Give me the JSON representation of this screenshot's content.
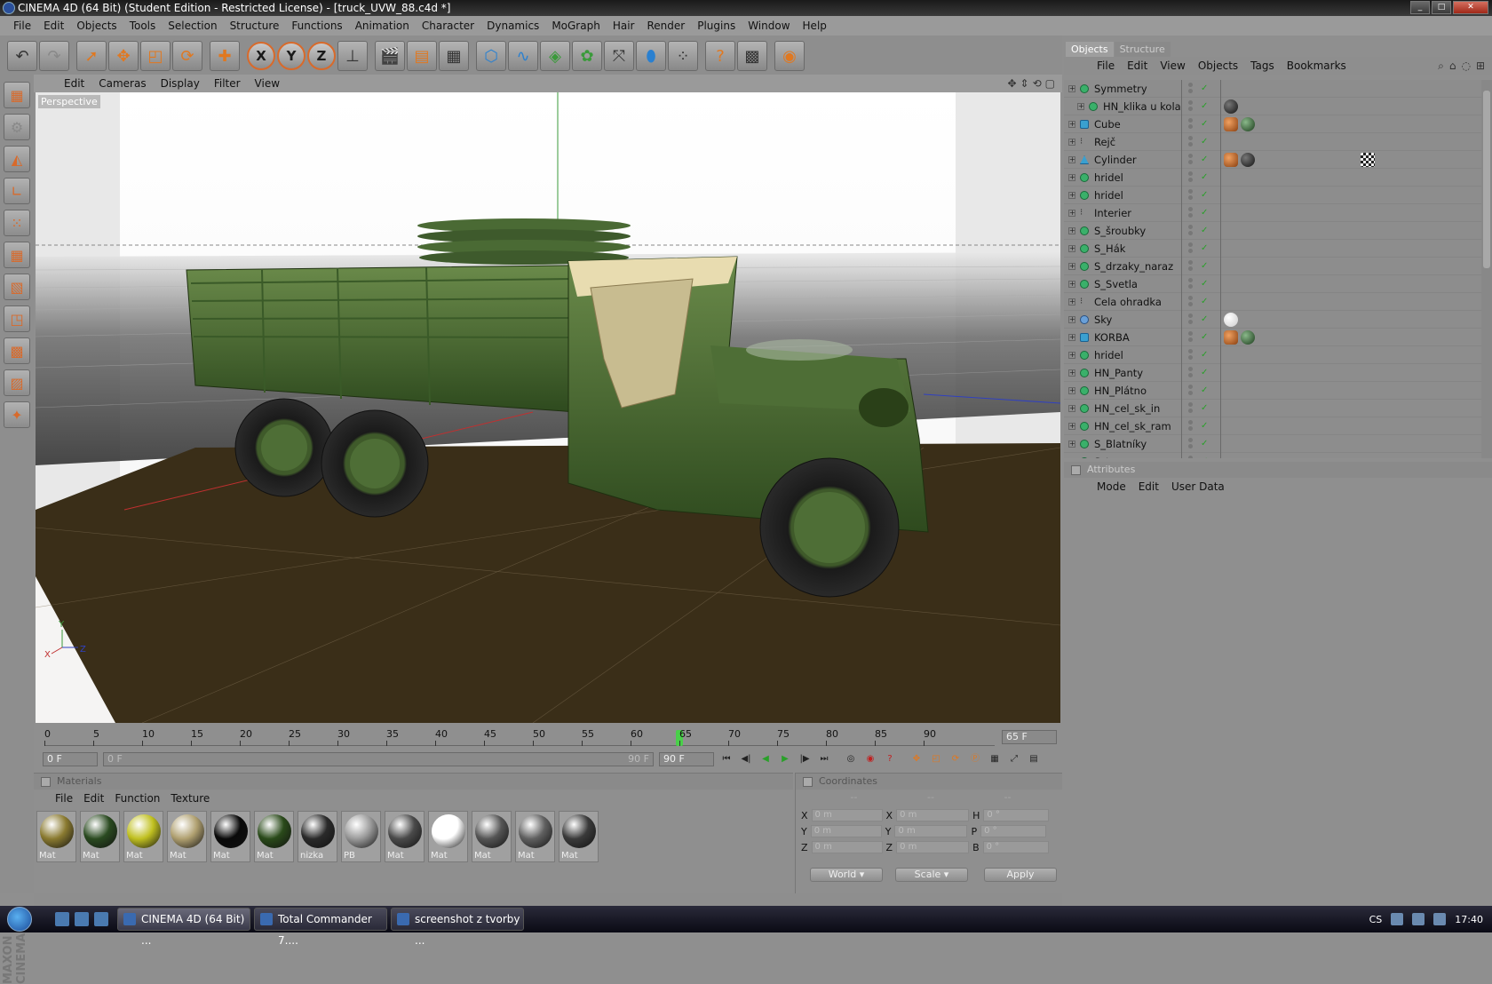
{
  "window": {
    "title": "CINEMA 4D (64 Bit) (Student Edition - Restricted License) - [truck_UVW_88.c4d *]"
  },
  "menu": [
    "File",
    "Edit",
    "Objects",
    "Tools",
    "Selection",
    "Structure",
    "Functions",
    "Animation",
    "Character",
    "Dynamics",
    "MoGraph",
    "Hair",
    "Render",
    "Plugins",
    "Window",
    "Help"
  ],
  "viewport": {
    "menu": [
      "Edit",
      "Cameras",
      "Display",
      "Filter",
      "View"
    ],
    "label": "Perspective",
    "axis": {
      "y": "Y",
      "x": "X",
      "z": "Z"
    }
  },
  "timeline": {
    "ticks": [
      "0",
      "5",
      "10",
      "15",
      "20",
      "25",
      "30",
      "35",
      "40",
      "45",
      "50",
      "55",
      "60",
      "65",
      "70",
      "75",
      "80",
      "85",
      "90"
    ],
    "current_frame": 65,
    "frame_display": "65 F",
    "start_field": "0 F",
    "range_left": "0 F",
    "range_right": "90 F",
    "end_field": "90 F"
  },
  "materials": {
    "title": "Materials",
    "menu": [
      "File",
      "Edit",
      "Function",
      "Texture"
    ],
    "items": [
      {
        "label": "Mat",
        "color": "#8a7a30"
      },
      {
        "label": "Mat",
        "color": "#2a4a20"
      },
      {
        "label": "Mat",
        "color": "#c0c020"
      },
      {
        "label": "Mat",
        "color": "#b0a070"
      },
      {
        "label": "Mat",
        "color": "#0a0a0a"
      },
      {
        "label": "Mat",
        "color": "#2a4a1a"
      },
      {
        "label": "nizka",
        "color": "#2a2a2a"
      },
      {
        "label": "PB",
        "color": "#9a9a9a"
      },
      {
        "label": "Mat",
        "color": "#4a4a4a"
      },
      {
        "label": "Mat",
        "color": "#ffffff"
      },
      {
        "label": "Mat",
        "color": "#555555"
      },
      {
        "label": "Mat",
        "color": "#606060"
      },
      {
        "label": "Mat",
        "color": "#3a3a3a"
      }
    ]
  },
  "coordinates": {
    "title": "Coordinates",
    "dash": "--",
    "rows": [
      {
        "a": "X",
        "av": "0 m",
        "b": "X",
        "bv": "0 m",
        "c": "H",
        "cv": "0 °"
      },
      {
        "a": "Y",
        "av": "0 m",
        "b": "Y",
        "bv": "0 m",
        "c": "P",
        "cv": "0 °"
      },
      {
        "a": "Z",
        "av": "0 m",
        "b": "Z",
        "bv": "0 m",
        "c": "B",
        "cv": "0 °"
      }
    ],
    "world": "World",
    "scale": "Scale",
    "apply": "Apply"
  },
  "objects_panel": {
    "tabs": [
      "Objects",
      "Structure"
    ],
    "menu": [
      "File",
      "Edit",
      "View",
      "Objects",
      "Tags",
      "Bookmarks"
    ],
    "rows": [
      {
        "name": "Symmetry",
        "icon": "green",
        "indent": 0,
        "tags": []
      },
      {
        "name": "HN_klika u kola",
        "icon": "green",
        "indent": 1,
        "tags": [
          "dark"
        ]
      },
      {
        "name": "Cube",
        "icon": "cube",
        "indent": 0,
        "tags": [
          "uvw",
          "green"
        ]
      },
      {
        "name": "Rejč",
        "icon": "null",
        "indent": 0,
        "tags": []
      },
      {
        "name": "Cylinder",
        "icon": "cyl",
        "indent": 0,
        "tags": [
          "uvw",
          "check",
          "dark"
        ]
      },
      {
        "name": "hridel",
        "icon": "green",
        "indent": 0,
        "tags": []
      },
      {
        "name": "hridel",
        "icon": "green",
        "indent": 0,
        "tags": []
      },
      {
        "name": "Interier",
        "icon": "null",
        "indent": 0,
        "tags": []
      },
      {
        "name": "S_šroubky",
        "icon": "green",
        "indent": 0,
        "tags": []
      },
      {
        "name": "S_Hák",
        "icon": "green",
        "indent": 0,
        "tags": []
      },
      {
        "name": "S_drzaky_naraz",
        "icon": "green",
        "indent": 0,
        "tags": []
      },
      {
        "name": "S_Svetla",
        "icon": "green",
        "indent": 0,
        "tags": []
      },
      {
        "name": "Cela ohradka",
        "icon": "null",
        "indent": 0,
        "tags": []
      },
      {
        "name": "Sky",
        "icon": "sky",
        "indent": 0,
        "tags": [
          "white"
        ]
      },
      {
        "name": "KORBA",
        "icon": "cube",
        "indent": 0,
        "tags": [
          "uvw",
          "green"
        ]
      },
      {
        "name": "hridel",
        "icon": "green",
        "indent": 0,
        "tags": []
      },
      {
        "name": "HN_Panty",
        "icon": "green",
        "indent": 0,
        "tags": []
      },
      {
        "name": "HN_Plátno",
        "icon": "green",
        "indent": 0,
        "tags": []
      },
      {
        "name": "HN_cel_sk_in",
        "icon": "green",
        "indent": 0,
        "tags": []
      },
      {
        "name": "HN_cel_sk_ram",
        "icon": "green",
        "indent": 0,
        "tags": []
      },
      {
        "name": "S_Blatníky",
        "icon": "green",
        "indent": 0,
        "tags": []
      },
      {
        "name": "S_tramy",
        "icon": "green",
        "indent": 0,
        "tags": []
      }
    ]
  },
  "attributes": {
    "title": "Attributes",
    "menu": [
      "Mode",
      "Edit",
      "User Data"
    ]
  },
  "taskbar": {
    "tasks": [
      "CINEMA 4D (64 Bit) ...",
      "Total Commander 7....",
      "screenshot z tvorby ..."
    ],
    "lang": "CS",
    "time": "17:40"
  }
}
